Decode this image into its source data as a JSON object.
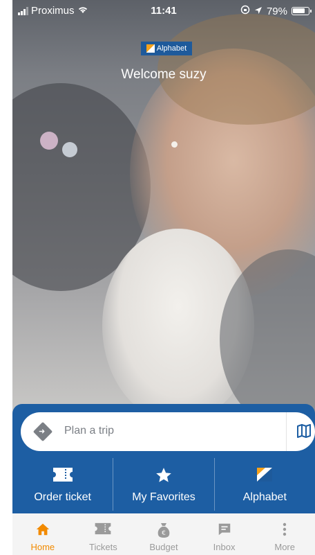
{
  "status_bar": {
    "carrier": "Proximus",
    "time": "11:41",
    "battery": "79%"
  },
  "brand": {
    "logo_text": "Alphabet",
    "color_primary": "#1d5ea3",
    "color_accent": "#f28a00"
  },
  "hero": {
    "welcome": "Welcome suzy"
  },
  "search": {
    "placeholder": "Plan a trip",
    "left_icon": "directions-icon",
    "right_icon": "map-icon"
  },
  "actions": [
    {
      "label": "Order ticket",
      "icon": "ticket-icon"
    },
    {
      "label": "My Favorites",
      "icon": "star-icon"
    },
    {
      "label": "Alphabet",
      "icon": "alphabet-logo-icon"
    }
  ],
  "tabs": [
    {
      "label": "Home",
      "icon": "home-icon",
      "active": true
    },
    {
      "label": "Tickets",
      "icon": "ticket-icon",
      "active": false
    },
    {
      "label": "Budget",
      "icon": "money-bag-icon",
      "active": false
    },
    {
      "label": "Inbox",
      "icon": "message-icon",
      "active": false
    },
    {
      "label": "More",
      "icon": "more-vertical-icon",
      "active": false
    }
  ]
}
